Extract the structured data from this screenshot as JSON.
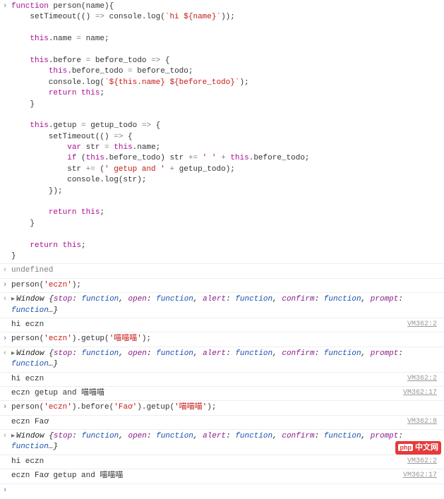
{
  "code": {
    "l1": "function person(name){",
    "l2": "    setTimeout(() => console.log(`hi ${name}`));",
    "l3": "",
    "l4": "    this.name = name;",
    "l5": "",
    "l6": "    this.before = before_todo => {",
    "l7": "        this.before_todo = before_todo;",
    "l8": "        console.log(`${this.name} ${before_todo}`);",
    "l9": "        return this;",
    "l10": "    }",
    "l11": "",
    "l12": "    this.getup = getup_todo => {",
    "l13": "        setTimeout(() => {",
    "l14": "            var str = this.name;",
    "l15": "            if (this.before_todo) str += ' ' + this.before_todo;",
    "l16": "            str += (' getup and ' + getup_todo);",
    "l17": "            console.log(str);",
    "l18": "        });",
    "l19": "",
    "l20": "        return this;",
    "l21": "    }",
    "l22": "",
    "l23": "    return this;",
    "l24": "}"
  },
  "console": [
    {
      "kind": "out",
      "text": "undefined",
      "cls": "und"
    },
    {
      "kind": "in",
      "text": "person('eczn');"
    },
    {
      "kind": "obj",
      "text": "Window {stop: function, open: function, alert: function, confirm: function, prompt: function…}"
    },
    {
      "kind": "log",
      "text": "hi eczn",
      "src": "VM362:2"
    },
    {
      "kind": "in",
      "text": "person('eczn').getup('喵喵喵');"
    },
    {
      "kind": "obj",
      "text": "Window {stop: function, open: function, alert: function, confirm: function, prompt: function…}"
    },
    {
      "kind": "log",
      "text": "hi eczn",
      "src": "VM362:2"
    },
    {
      "kind": "log",
      "text": "eczn getup and 喵喵喵",
      "src": "VM362:17"
    },
    {
      "kind": "in",
      "text": "person('eczn').before('Faơ').getup('喵喵喵');"
    },
    {
      "kind": "log",
      "text": "eczn Faơ",
      "src": "VM362:8"
    },
    {
      "kind": "obj",
      "text": "Window {stop: function, open: function, alert: function, confirm: function, prompt: function…}"
    },
    {
      "kind": "log",
      "text": "hi eczn",
      "src": "VM362:2"
    },
    {
      "kind": "log",
      "text": "eczn Faơ getup and 喵喵喵",
      "src": "VM362:17"
    }
  ],
  "prompts": {
    "input": "›",
    "output": "‹",
    "triangle_right": "▸"
  },
  "badge": "php 中文网"
}
